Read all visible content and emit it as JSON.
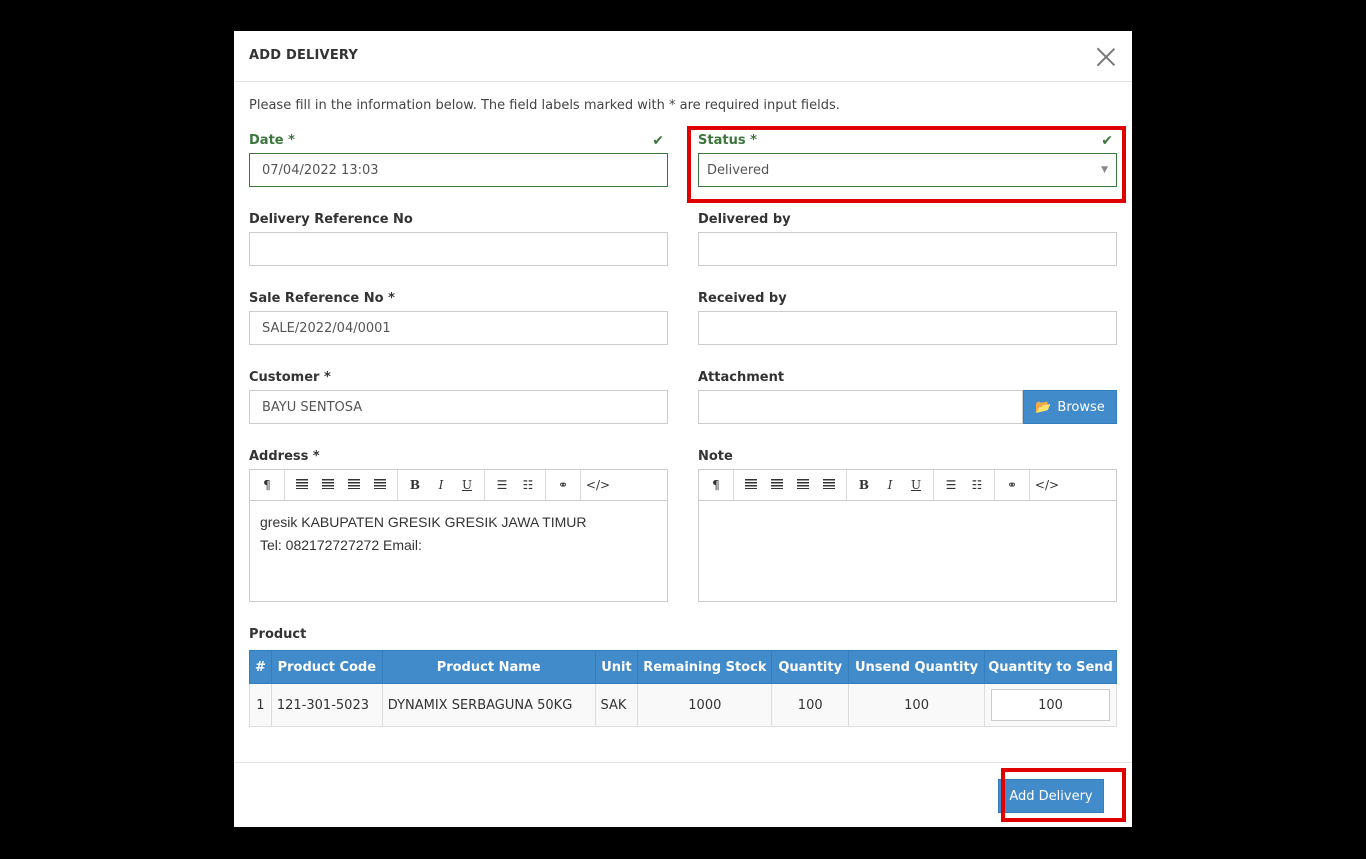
{
  "modal": {
    "title": "ADD DELIVERY",
    "intro": "Please fill in the information below. The field labels marked with * are required input fields."
  },
  "fields": {
    "date": {
      "label": "Date *",
      "value": "07/04/2022 13:03"
    },
    "status": {
      "label": "Status *",
      "value": "Delivered"
    },
    "delivery_ref": {
      "label": "Delivery Reference No",
      "value": ""
    },
    "delivered_by": {
      "label": "Delivered by",
      "value": ""
    },
    "sale_ref": {
      "label": "Sale Reference No *",
      "value": "SALE/2022/04/0001"
    },
    "received_by": {
      "label": "Received by",
      "value": ""
    },
    "customer": {
      "label": "Customer *",
      "value": "BAYU SENTOSA"
    },
    "attachment": {
      "label": "Attachment",
      "value": "",
      "browse_label": "Browse"
    },
    "address": {
      "label": "Address *",
      "line1": "gresik KABUPATEN GRESIK GRESIK JAWA TIMUR",
      "line2": "Tel: 082172727272 Email:"
    },
    "note": {
      "label": "Note",
      "value": ""
    }
  },
  "toolbar": {
    "paragraph": "¶",
    "bold": "B",
    "italic": "I",
    "underline": "U",
    "code": "</>"
  },
  "product": {
    "label": "Product",
    "columns": [
      "#",
      "Product Code",
      "Product Name",
      "Unit",
      "Remaining Stock",
      "Quantity",
      "Unsend Quantity",
      "Quantity to Send"
    ],
    "rows": [
      {
        "no": "1",
        "code": "121-301-5023",
        "name": "DYNAMIX SERBAGUNA 50KG",
        "unit": "SAK",
        "remaining": "1000",
        "quantity": "100",
        "unsend": "100",
        "to_send": "100"
      }
    ]
  },
  "footer": {
    "add_label": "Add Delivery"
  },
  "colors": {
    "primary": "#428bca",
    "success": "#3c763d",
    "highlight": "#e00000"
  }
}
